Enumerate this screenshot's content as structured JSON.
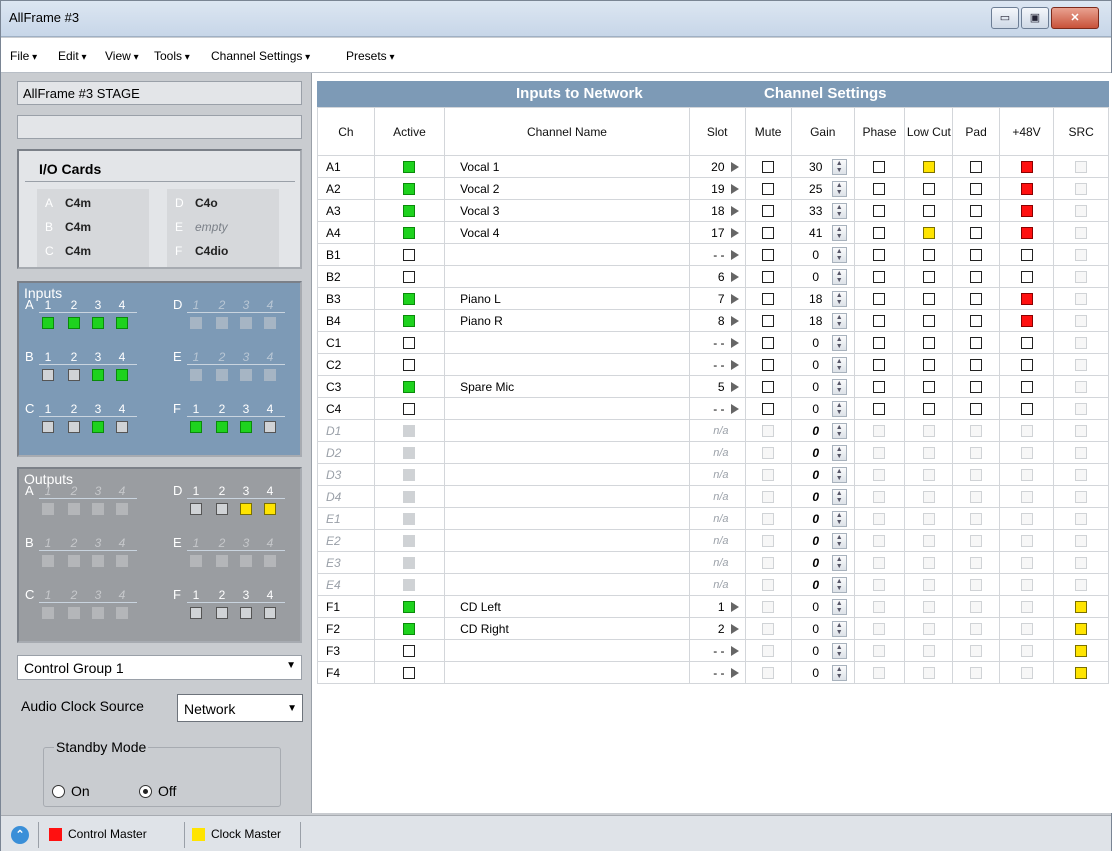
{
  "window": {
    "title": "AllFrame #3",
    "min": "▭",
    "max": "▣",
    "close": "✕"
  },
  "menu": [
    "File",
    "Edit",
    "View",
    "Tools",
    "Channel Settings",
    "Presets"
  ],
  "left": {
    "stage": "AllFrame #3 STAGE",
    "stage2": "",
    "io_title": "I/O Cards",
    "cards": [
      {
        "letter": "A",
        "value": "C4m",
        "empty": false
      },
      {
        "letter": "B",
        "value": "C4m",
        "empty": false
      },
      {
        "letter": "C",
        "value": "C4m",
        "empty": false
      },
      {
        "letter": "D",
        "value": "C4o",
        "empty": false
      },
      {
        "letter": "E",
        "value": "empty",
        "empty": true
      },
      {
        "letter": "F",
        "value": "C4dio",
        "empty": false
      }
    ],
    "inputs_title": "Inputs",
    "outputs_title": "Outputs",
    "numbers": [
      "1",
      "2",
      "3",
      "4"
    ],
    "inputs": [
      {
        "letter": "A",
        "active": true,
        "states": [
          "g",
          "g",
          "g",
          "g"
        ]
      },
      {
        "letter": "D",
        "active": false,
        "states": [
          "d",
          "d",
          "d",
          "d"
        ]
      },
      {
        "letter": "B",
        "active": true,
        "states": [
          "o",
          "o",
          "g",
          "g"
        ]
      },
      {
        "letter": "E",
        "active": false,
        "states": [
          "d",
          "d",
          "d",
          "d"
        ]
      },
      {
        "letter": "C",
        "active": true,
        "states": [
          "o",
          "o",
          "g",
          "o"
        ]
      },
      {
        "letter": "F",
        "active": true,
        "states": [
          "g",
          "g",
          "g",
          "o"
        ]
      }
    ],
    "outputs": [
      {
        "letter": "A",
        "active": false,
        "states": [
          "d",
          "d",
          "d",
          "d"
        ]
      },
      {
        "letter": "D",
        "active": true,
        "states": [
          "o",
          "o",
          "y",
          "y"
        ]
      },
      {
        "letter": "B",
        "active": false,
        "states": [
          "d",
          "d",
          "d",
          "d"
        ]
      },
      {
        "letter": "E",
        "active": false,
        "states": [
          "d",
          "d",
          "d",
          "d"
        ]
      },
      {
        "letter": "C",
        "active": false,
        "states": [
          "d",
          "d",
          "d",
          "d"
        ]
      },
      {
        "letter": "F",
        "active": true,
        "states": [
          "o",
          "o",
          "o",
          "o"
        ]
      }
    ],
    "control_group": "Control Group 1",
    "clock_label": "Audio Clock Source",
    "clock_value": "Network",
    "standby_label": "Standby Mode",
    "standby_on": "On",
    "standby_off": "Off"
  },
  "main": {
    "hdr_inputs": "Inputs to Network",
    "hdr_settings": "Channel Settings",
    "columns": [
      "Ch",
      "Active",
      "Channel Name",
      "Slot",
      "Mute",
      "Gain",
      "Phase",
      "Low Cut",
      "Pad",
      "+48V",
      "SRC"
    ],
    "rows": [
      {
        "ch": "A1",
        "dis": false,
        "active": "g",
        "name": "Vocal 1",
        "slot": "20",
        "arrow": true,
        "gain": "30",
        "lowcut": "y",
        "p48": "r",
        "src": "off"
      },
      {
        "ch": "A2",
        "dis": false,
        "active": "g",
        "name": "Vocal 2",
        "slot": "19",
        "arrow": true,
        "gain": "25",
        "lowcut": "c",
        "p48": "r",
        "src": "off"
      },
      {
        "ch": "A3",
        "dis": false,
        "active": "g",
        "name": "Vocal 3",
        "slot": "18",
        "arrow": true,
        "gain": "33",
        "lowcut": "c",
        "p48": "r",
        "src": "off"
      },
      {
        "ch": "A4",
        "dis": false,
        "active": "g",
        "name": "Vocal 4",
        "slot": "17",
        "arrow": true,
        "gain": "41",
        "lowcut": "y",
        "p48": "r",
        "src": "off"
      },
      {
        "ch": "B1",
        "dis": false,
        "active": "c",
        "name": "",
        "slot": "- -",
        "arrow": true,
        "gain": "0",
        "lowcut": "c",
        "p48": "c",
        "src": "off"
      },
      {
        "ch": "B2",
        "dis": false,
        "active": "c",
        "name": "",
        "slot": "6",
        "arrow": true,
        "gain": "0",
        "lowcut": "c",
        "p48": "c",
        "src": "off"
      },
      {
        "ch": "B3",
        "dis": false,
        "active": "g",
        "name": "Piano L",
        "slot": "7",
        "arrow": true,
        "gain": "18",
        "lowcut": "c",
        "p48": "r",
        "src": "off"
      },
      {
        "ch": "B4",
        "dis": false,
        "active": "g",
        "name": "Piano R",
        "slot": "8",
        "arrow": true,
        "gain": "18",
        "lowcut": "c",
        "p48": "r",
        "src": "off"
      },
      {
        "ch": "C1",
        "dis": false,
        "active": "c",
        "name": "",
        "slot": "- -",
        "arrow": true,
        "gain": "0",
        "lowcut": "c",
        "p48": "c",
        "src": "off"
      },
      {
        "ch": "C2",
        "dis": false,
        "active": "c",
        "name": "",
        "slot": "- -",
        "arrow": true,
        "gain": "0",
        "lowcut": "c",
        "p48": "c",
        "src": "off"
      },
      {
        "ch": "C3",
        "dis": false,
        "active": "g",
        "name": "Spare Mic",
        "slot": "5",
        "arrow": true,
        "gain": "0",
        "lowcut": "c",
        "p48": "c",
        "src": "off"
      },
      {
        "ch": "C4",
        "dis": false,
        "active": "c",
        "name": "",
        "slot": "- -",
        "arrow": true,
        "gain": "0",
        "lowcut": "c",
        "p48": "c",
        "src": "off"
      },
      {
        "ch": "D1",
        "dis": true,
        "active": "dg",
        "name": "",
        "slot": "n/a",
        "arrow": false,
        "gain": "0",
        "lowcut": "off",
        "p48": "off",
        "src": "off"
      },
      {
        "ch": "D2",
        "dis": true,
        "active": "dg",
        "name": "",
        "slot": "n/a",
        "arrow": false,
        "gain": "0",
        "lowcut": "off",
        "p48": "off",
        "src": "off"
      },
      {
        "ch": "D3",
        "dis": true,
        "active": "dg",
        "name": "",
        "slot": "n/a",
        "arrow": false,
        "gain": "0",
        "lowcut": "off",
        "p48": "off",
        "src": "off"
      },
      {
        "ch": "D4",
        "dis": true,
        "active": "dg",
        "name": "",
        "slot": "n/a",
        "arrow": false,
        "gain": "0",
        "lowcut": "off",
        "p48": "off",
        "src": "off"
      },
      {
        "ch": "E1",
        "dis": true,
        "active": "dg",
        "name": "",
        "slot": "n/a",
        "arrow": false,
        "gain": "0",
        "lowcut": "off",
        "p48": "off",
        "src": "off"
      },
      {
        "ch": "E2",
        "dis": true,
        "active": "dg",
        "name": "",
        "slot": "n/a",
        "arrow": false,
        "gain": "0",
        "lowcut": "off",
        "p48": "off",
        "src": "off"
      },
      {
        "ch": "E3",
        "dis": true,
        "active": "dg",
        "name": "",
        "slot": "n/a",
        "arrow": false,
        "gain": "0",
        "lowcut": "off",
        "p48": "off",
        "src": "off"
      },
      {
        "ch": "E4",
        "dis": true,
        "active": "dg",
        "name": "",
        "slot": "n/a",
        "arrow": false,
        "gain": "0",
        "lowcut": "off",
        "p48": "off",
        "src": "off"
      },
      {
        "ch": "F1",
        "dis": false,
        "active": "g",
        "name": "CD Left",
        "slot": "1",
        "arrow": true,
        "gain": "0",
        "lowcut": "off",
        "p48": "off",
        "src": "y"
      },
      {
        "ch": "F2",
        "dis": false,
        "active": "g",
        "name": "CD Right",
        "slot": "2",
        "arrow": true,
        "gain": "0",
        "lowcut": "off",
        "p48": "off",
        "src": "y"
      },
      {
        "ch": "F3",
        "dis": false,
        "active": "c",
        "name": "",
        "slot": "- -",
        "arrow": true,
        "gain": "0",
        "lowcut": "off",
        "p48": "off",
        "src": "y"
      },
      {
        "ch": "F4",
        "dis": false,
        "active": "c",
        "name": "",
        "slot": "- -",
        "arrow": true,
        "gain": "0",
        "lowcut": "off",
        "p48": "off",
        "src": "y"
      }
    ]
  },
  "status": {
    "control_master": "Control Master",
    "clock_master": "Clock Master",
    "control_color": "#ff1010",
    "clock_color": "#ffe400"
  }
}
